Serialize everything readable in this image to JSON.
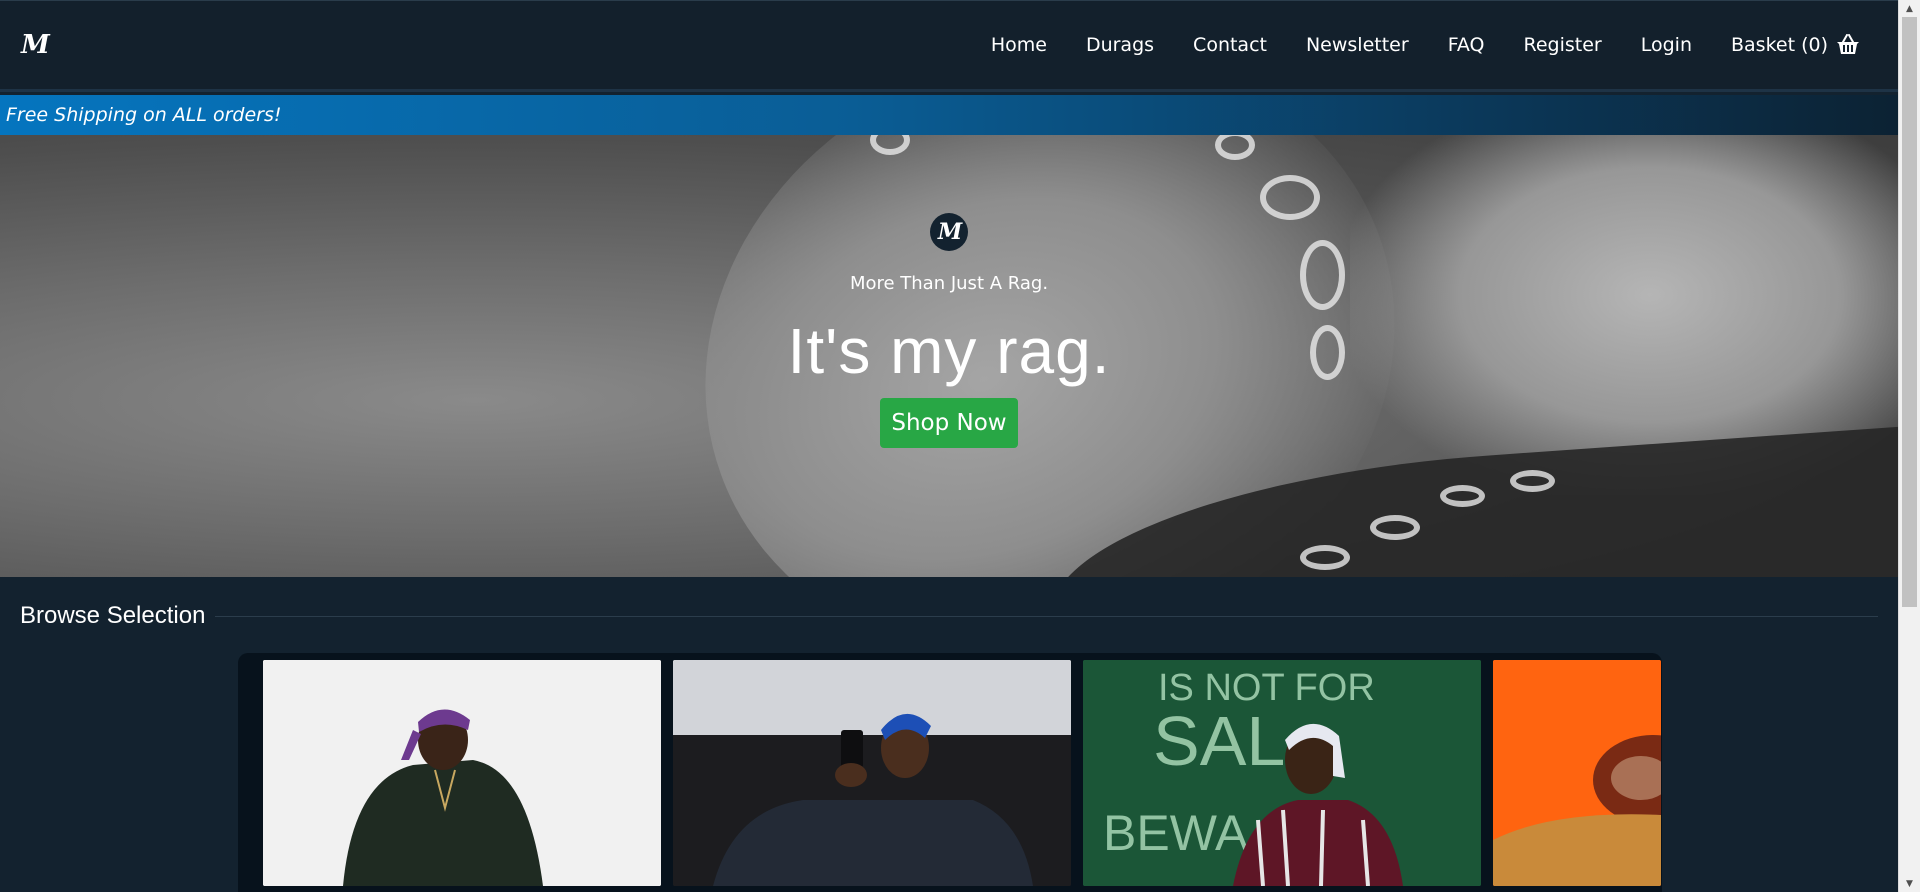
{
  "navbar": {
    "brand": "M",
    "links": [
      "Home",
      "Durags",
      "Contact",
      "Newsletter",
      "FAQ",
      "Register",
      "Login"
    ],
    "basket_label": "Basket (0)"
  },
  "promo": {
    "text": "Free Shipping on ALL orders!"
  },
  "hero": {
    "logo": "M",
    "tagline": "More Than Just A Rag.",
    "title": "It's my rag.",
    "cta": "Shop Now"
  },
  "browse": {
    "title": "Browse Selection",
    "products": [
      {
        "name": "purple-durag-product",
        "accent": "#7a3fa0"
      },
      {
        "name": "blue-durag-product",
        "accent": "#1a4fb8"
      },
      {
        "name": "white-durag-product",
        "accent": "#e8e8ee"
      },
      {
        "name": "orange-product",
        "accent": "#ff6a10"
      }
    ]
  },
  "colors": {
    "background": "#13222f",
    "accent_green": "#28a745",
    "promo_blue": "#0575bf"
  }
}
